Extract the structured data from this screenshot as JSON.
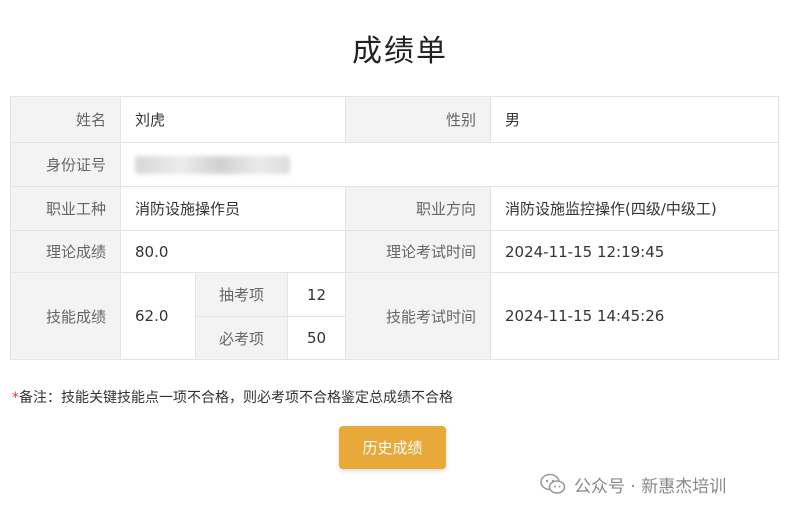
{
  "page": {
    "title": "成绩单"
  },
  "table": {
    "name_label": "姓名",
    "name_value": "刘虎",
    "gender_label": "性别",
    "gender_value": "男",
    "id_label": "身份证号",
    "job_label": "职业工种",
    "job_value": "消防设施操作员",
    "direction_label": "职业方向",
    "direction_value": "消防设施监控操作(四级/中级工)",
    "theory_score_label": "理论成绩",
    "theory_score_value": "80.0",
    "theory_time_label": "理论考试时间",
    "theory_time_value": "2024-11-15 12:19:45",
    "skill_score_label": "技能成绩",
    "skill_score_value": "62.0",
    "random_item_label": "抽考项",
    "random_item_value": "12",
    "required_item_label": "必考项",
    "required_item_value": "50",
    "skill_time_label": "技能考试时间",
    "skill_time_value": "2024-11-15 14:45:26"
  },
  "note": {
    "star": "*",
    "text": "备注：技能关键技能点一项不合格，则必考项不合格鉴定总成绩不合格"
  },
  "history_button": {
    "label": "历史成绩"
  },
  "watermark": {
    "text": "公众号 · 新惠杰培训"
  },
  "colors": {
    "button": "#e9a93a",
    "skill_score": "#3b8fd6",
    "note_star": "#e23b3b"
  }
}
